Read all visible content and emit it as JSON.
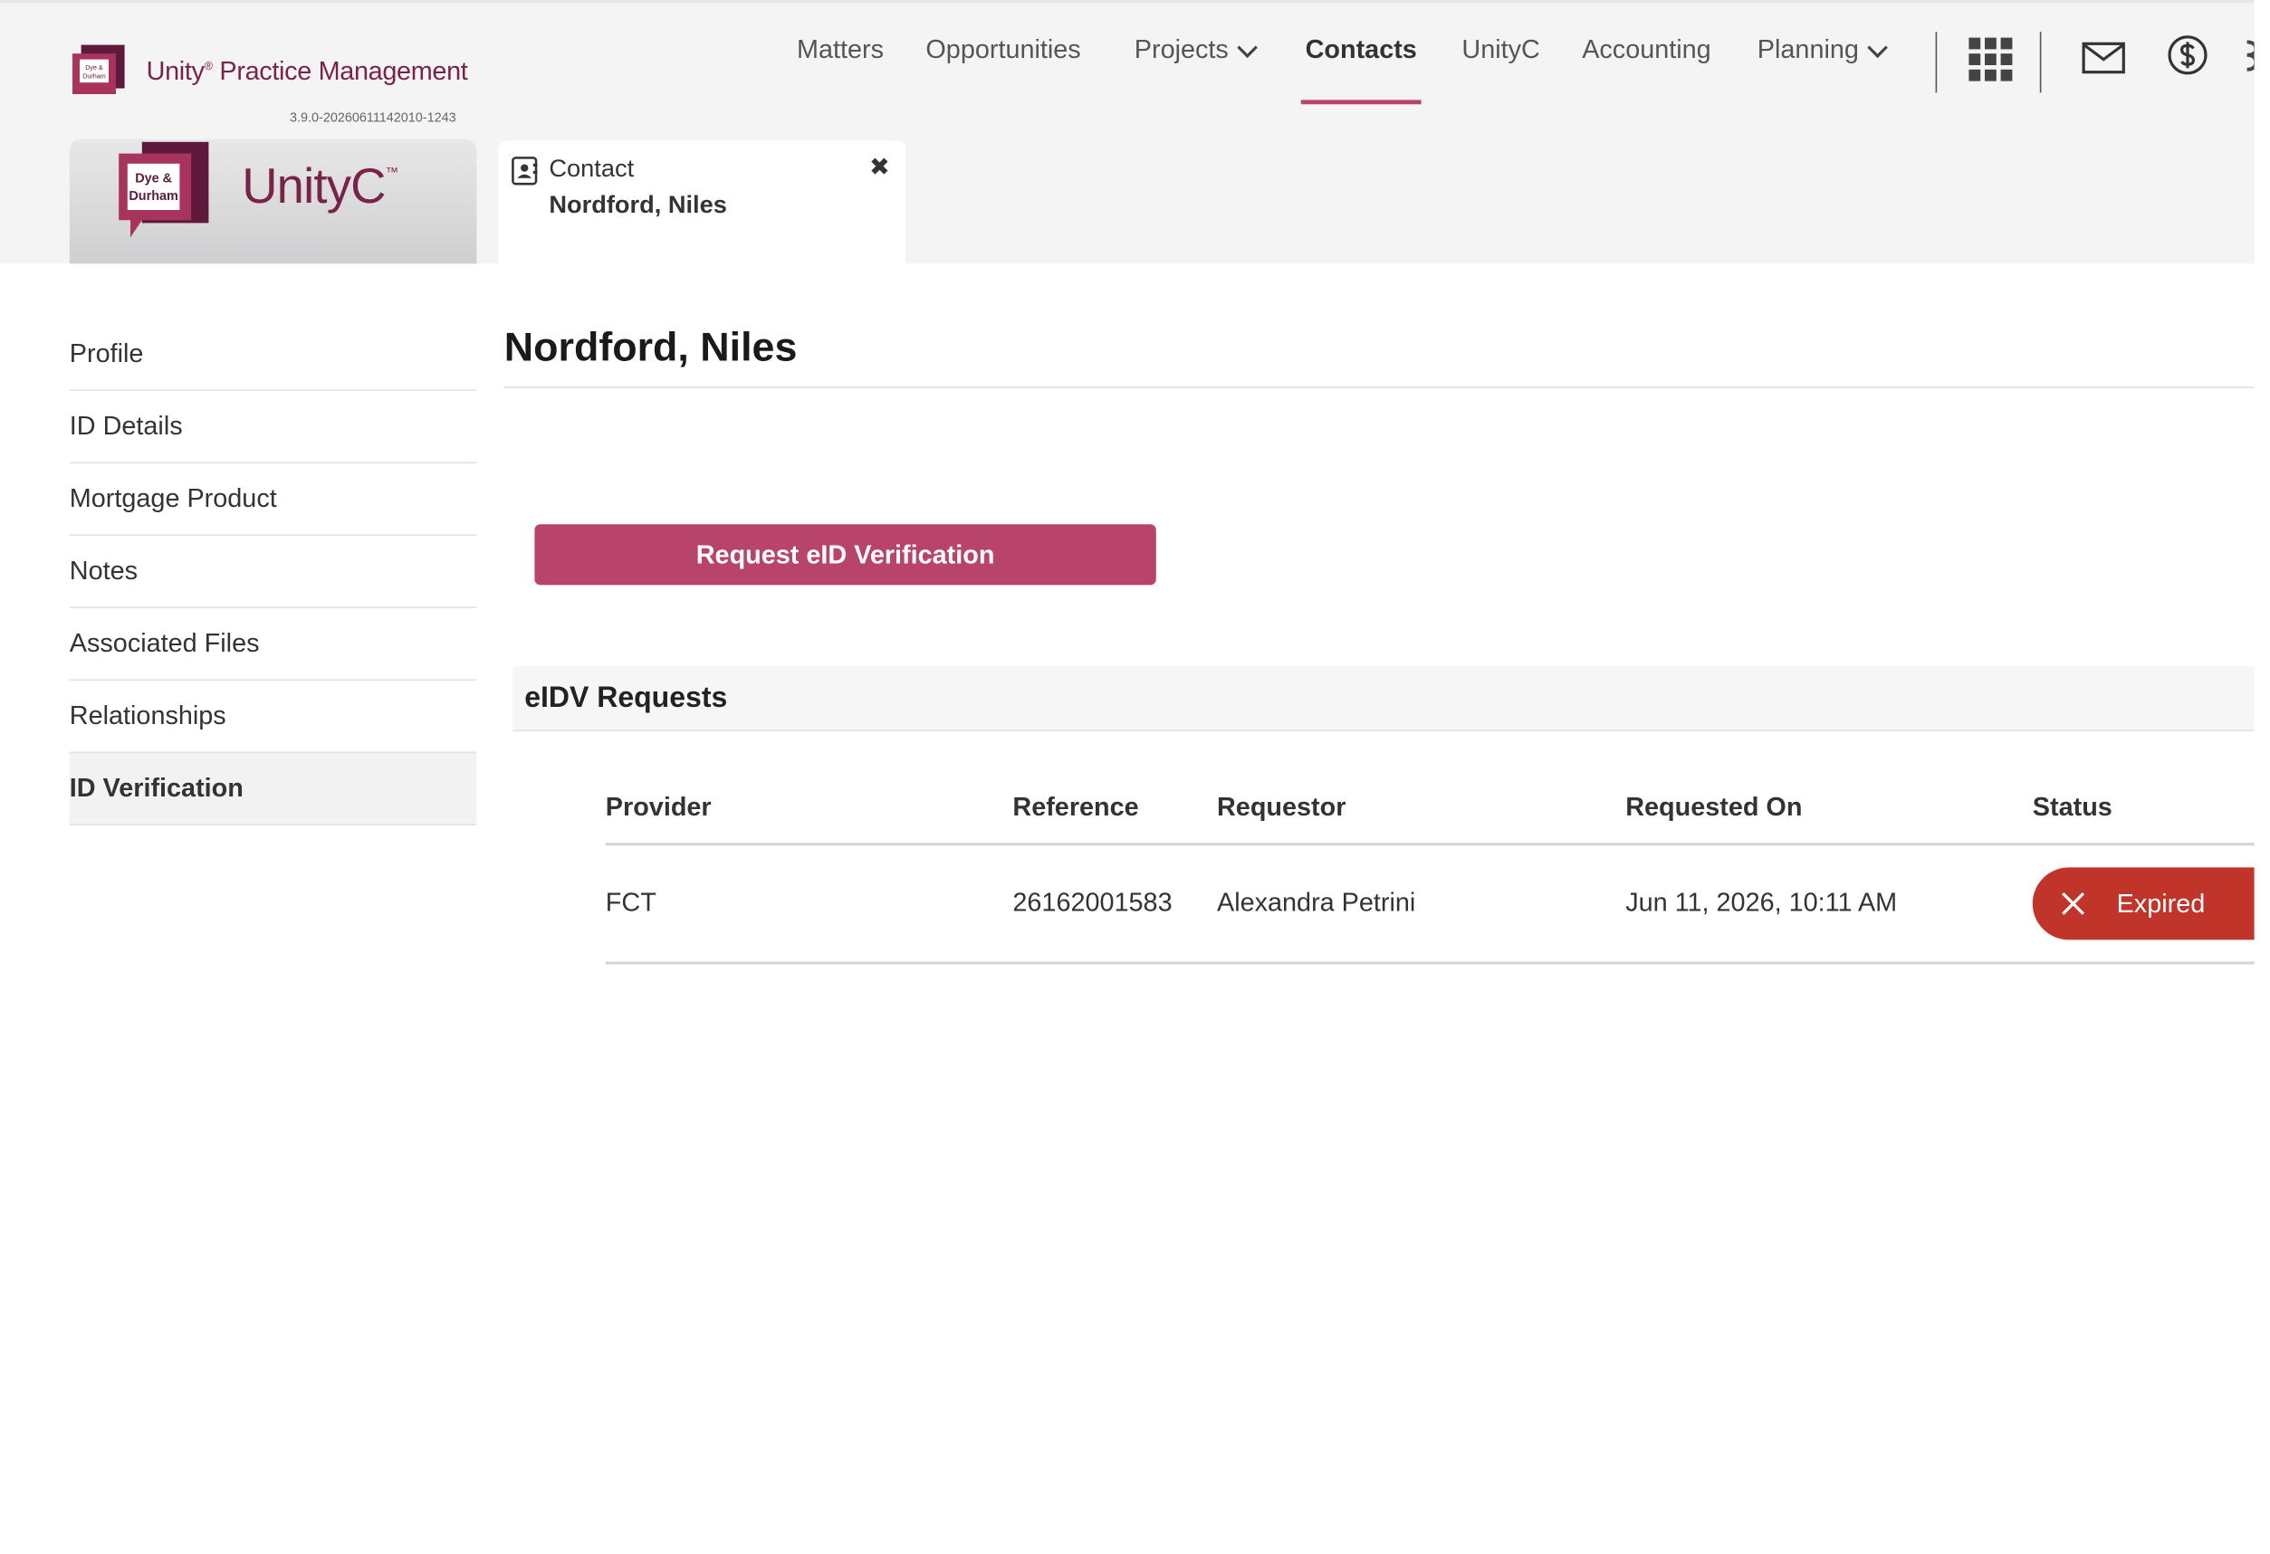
{
  "brand": {
    "name": "Unity",
    "name_suffix": " Practice Management",
    "registered": "®",
    "version": "3.9.0-20260611142010-1243",
    "mark_text_line1": "Dye &",
    "mark_text_line2": "Durham"
  },
  "nav": {
    "items": [
      {
        "label": "Matters"
      },
      {
        "label": "Opportunities"
      },
      {
        "label": "Projects"
      },
      {
        "label": "Contacts"
      },
      {
        "label": "UnityC"
      },
      {
        "label": "Accounting"
      },
      {
        "label": "Planning"
      }
    ],
    "active": "Contacts"
  },
  "unityc_card": {
    "label": "UnityC",
    "tm": "™",
    "mark_text_line1": "Dye &",
    "mark_text_line2": "Durham"
  },
  "tab": {
    "type": "Contact",
    "name": "Nordford, Niles",
    "close": "✖"
  },
  "sidebar": {
    "items": [
      {
        "label": "Profile"
      },
      {
        "label": "ID Details"
      },
      {
        "label": "Mortgage Product"
      },
      {
        "label": "Notes"
      },
      {
        "label": "Associated Files"
      },
      {
        "label": "Relationships"
      },
      {
        "label": "ID Verification"
      }
    ],
    "active": "ID Verification"
  },
  "page": {
    "title": "Nordford, Niles",
    "request_button": "Request eID Verification",
    "section_title": "eIDV Requests"
  },
  "table": {
    "columns": [
      "Provider",
      "Reference",
      "Requestor",
      "Requested On",
      "Status"
    ],
    "rows": [
      {
        "provider": "FCT",
        "reference": "26162001583",
        "requestor": "Alexandra Petrini",
        "requested_on": "Jun 11, 2026, 10:11 AM",
        "status": "Expired"
      }
    ]
  },
  "colors": {
    "brand": "#7a2349",
    "accent": "#b8446c",
    "status_expired": "#c0342a"
  }
}
